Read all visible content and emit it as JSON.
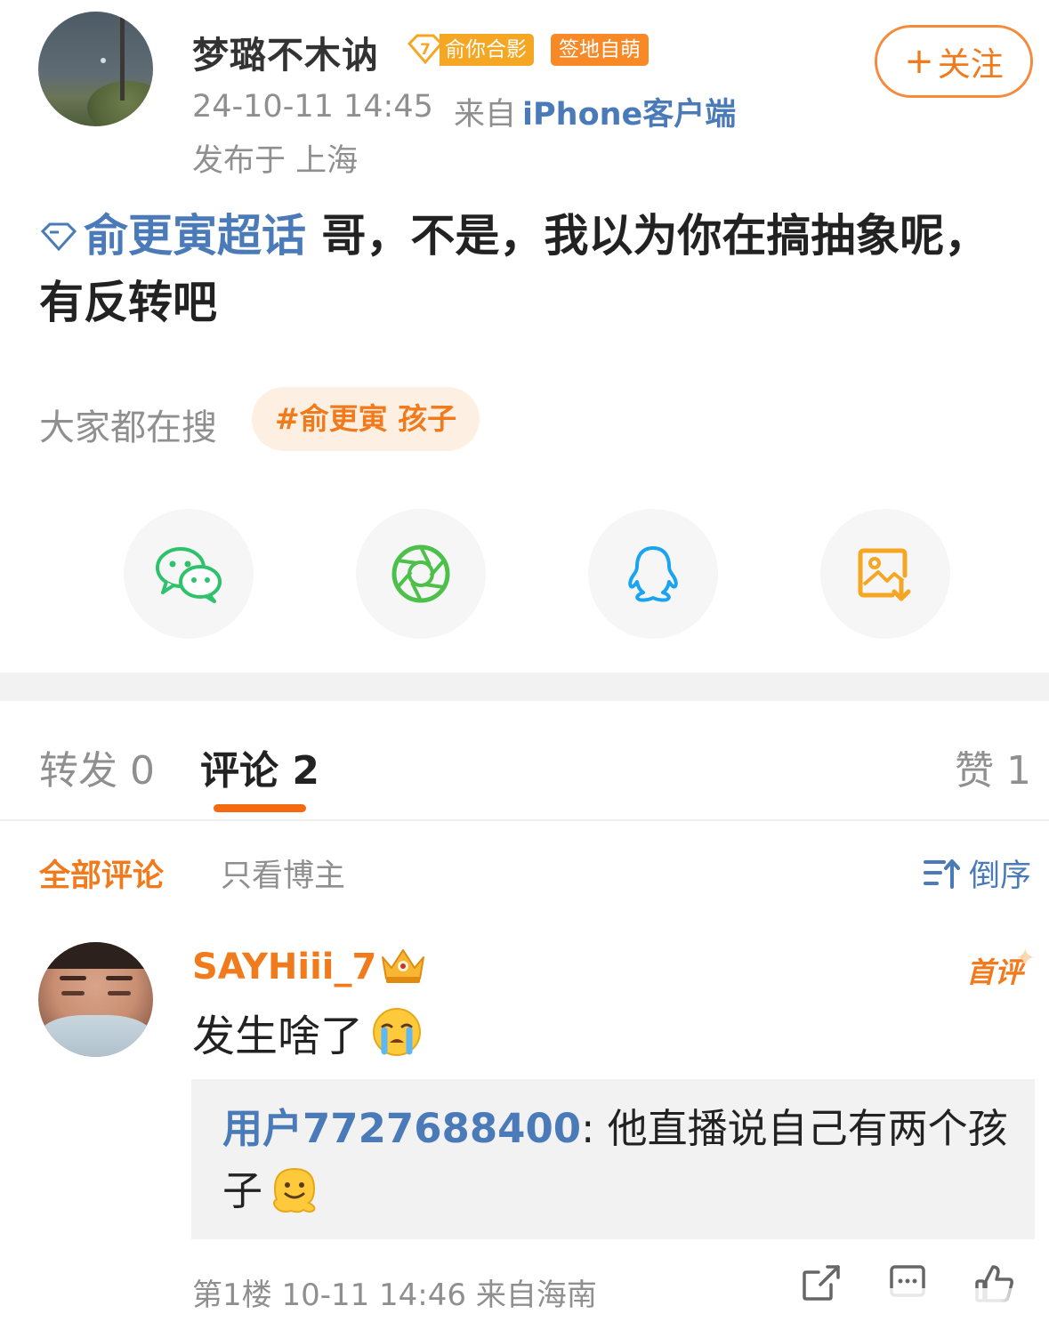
{
  "post": {
    "username": "梦璐不木讷",
    "fan_badge": {
      "level": "7",
      "label": "俞你合影"
    },
    "sign_badge": "签地自萌",
    "follow_label": "关注",
    "follow_plus": "+",
    "time": "24-10-11 14:45",
    "source_prefix": "来自",
    "device": "iPhone客户端",
    "location": "发布于 上海",
    "topic": "俞更寅超话",
    "body": " 哥，不是，我以为你在搞抽象呢，有反转吧",
    "trending_label": "大家都在搜",
    "trending_tag": "#俞更寅 孩子"
  },
  "share": {
    "items": [
      {
        "name": "wechat-icon",
        "color": "#2dc26b"
      },
      {
        "name": "moments-icon",
        "color": "#4cc04a"
      },
      {
        "name": "qq-icon",
        "color": "#1aa3f0"
      },
      {
        "name": "save-image-icon",
        "color": "#f5a623"
      }
    ]
  },
  "tabs": {
    "repost": "转发 0",
    "comment": "评论 2",
    "like": "赞 1"
  },
  "filters": {
    "all": "全部评论",
    "owner_only": "只看博主",
    "sort": "倒序"
  },
  "comment": {
    "username": "SAYHiii_7",
    "first_badge": "首评",
    "text": "发生啥了",
    "reply_user": "用户7727688400",
    "reply_text": ": 他直播说自己有两个孩子",
    "meta": "第1楼 10-11 14:46  来自海南"
  },
  "colors": {
    "accent": "#f17a1c",
    "link": "#4a7bb8",
    "muted": "#8f8f8f"
  }
}
